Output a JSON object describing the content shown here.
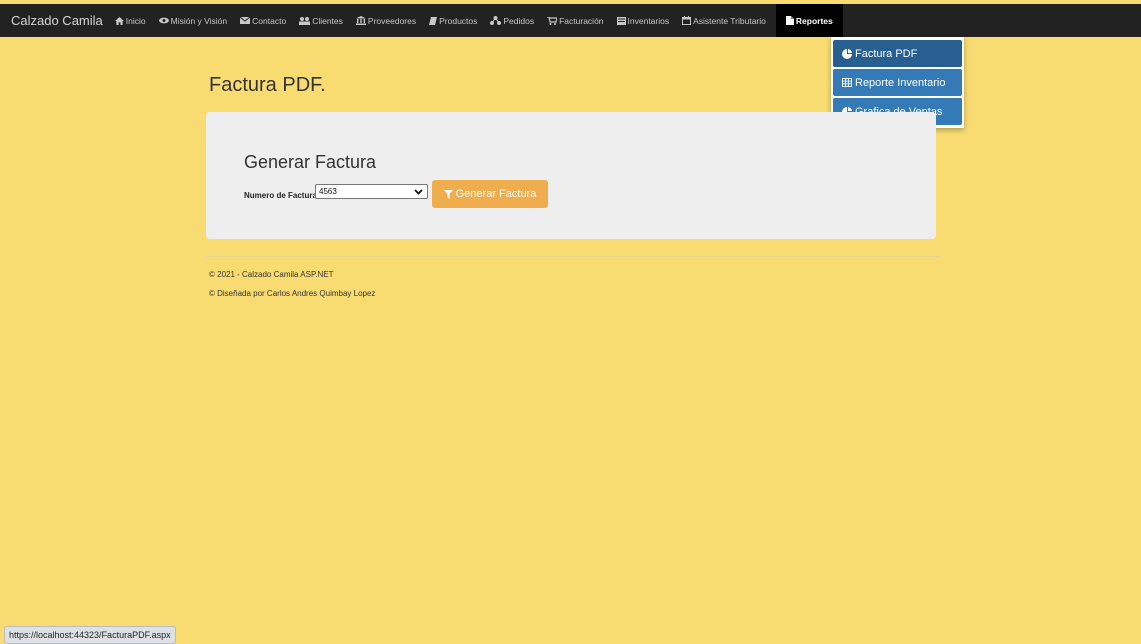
{
  "brand": "Calzado Camila",
  "nav": [
    {
      "label": "Inicio",
      "icon": "home-icon"
    },
    {
      "label": "Misión y Visión",
      "icon": "eye-icon"
    },
    {
      "label": "Contacto",
      "icon": "envelope-icon"
    },
    {
      "label": "Clientes",
      "icon": "users-icon"
    },
    {
      "label": "Proveedores",
      "icon": "bank-icon"
    },
    {
      "label": "Productos",
      "icon": "book-icon"
    },
    {
      "label": "Pedidos",
      "icon": "share-icon"
    },
    {
      "label": "Facturación",
      "icon": "cart-icon"
    },
    {
      "label": "Inventarios",
      "icon": "inbox-icon"
    },
    {
      "label": "Asistente Tributario",
      "icon": "calendar-icon"
    },
    {
      "label": "Reportes",
      "icon": "file-icon"
    }
  ],
  "dropdown": [
    {
      "label": "Factura PDF",
      "icon": "pie-chart-icon"
    },
    {
      "label": "Reporte Inventario",
      "icon": "table-icon"
    },
    {
      "label": "Grafica de Ventas",
      "icon": "pie-chart-icon"
    }
  ],
  "page_title": "Factura PDF.",
  "form": {
    "title": "Generar Factura",
    "field_label": "Numero de Factura:",
    "invoice_value": "4563",
    "button_label": "Generar Factura"
  },
  "footer": {
    "line1": "© 2021 - Calzado Camila ASP.NET",
    "line2": "© Diseñada por Carlos Andres Quimbay Lopez"
  },
  "status_url": "https://localhost:44323/FacturaPDF.aspx",
  "colors": {
    "background": "#f8dc72",
    "navbar": "#222222",
    "menu_item": "#337ab7",
    "button": "#f0ad4e",
    "panel": "#eeeeee"
  }
}
